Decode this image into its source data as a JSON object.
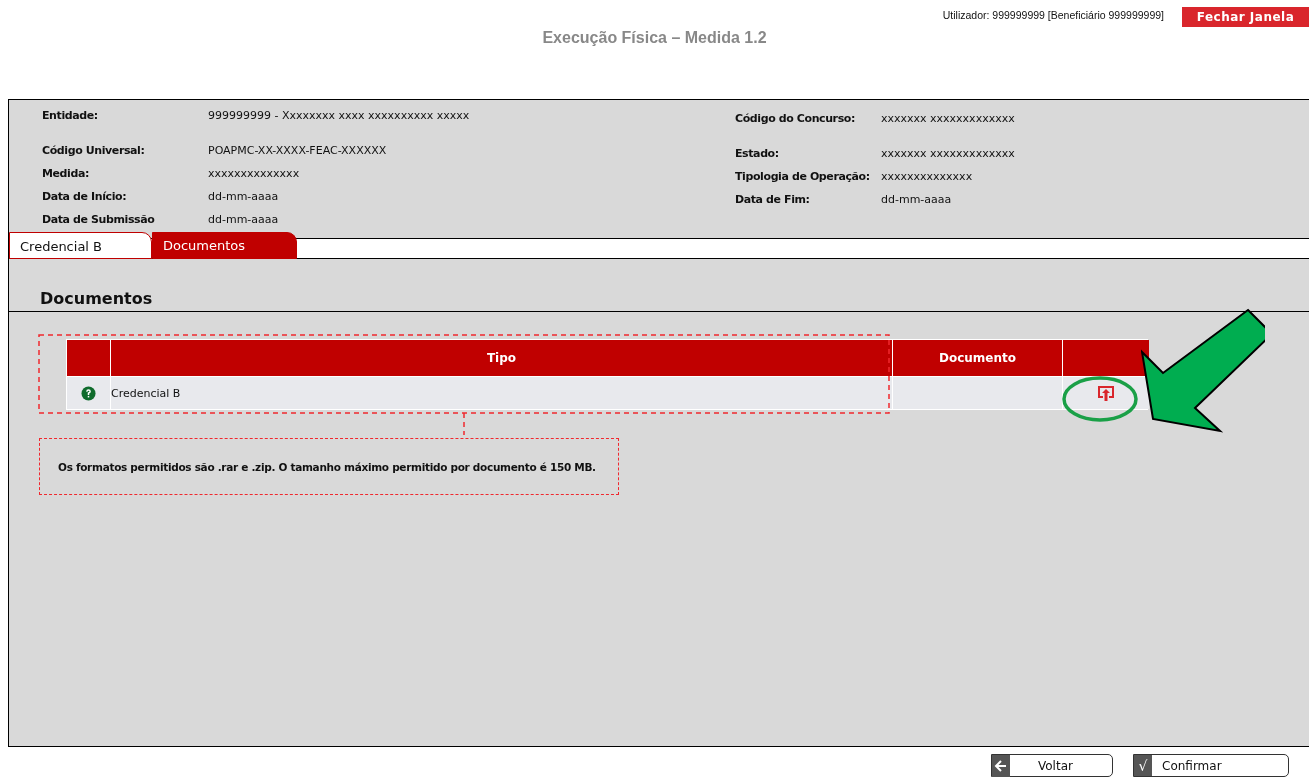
{
  "header": {
    "user": "Utilizador: 999999999 [Beneficiário 999999999]",
    "close_button": "Fechar Janela",
    "title": "Execução Física – Medida 1.2"
  },
  "info_left": [
    {
      "label": "Entidade:",
      "value": "999999999 - Xxxxxxxx xxxx xxxxxxxxxx xxxxx"
    },
    {
      "label": "Código Universal:",
      "value": "POAPMC-XX-XXXX-FEAC-XXXXXX"
    },
    {
      "label": "Medida:",
      "value": "xxxxxxxxxxxxxx"
    },
    {
      "label": "Data de Início:",
      "value": "dd-mm-aaaa"
    },
    {
      "label": "Data de Submissão",
      "value": "dd-mm-aaaa"
    }
  ],
  "info_right": [
    {
      "label": "Código do Concurso:",
      "value": "xxxxxxx xxxxxxxxxxxxx"
    },
    {
      "label": "Estado:",
      "value": "xxxxxxx xxxxxxxxxxxxx"
    },
    {
      "label": "Tipologia de Operação:",
      "value": "xxxxxxxxxxxxxx"
    },
    {
      "label": "Data de Fim:",
      "value": "dd-mm-aaaa"
    }
  ],
  "tabs": [
    {
      "label": "Credencial B",
      "selected": false
    },
    {
      "label": "Documentos",
      "selected": true
    }
  ],
  "section_title": "Documentos",
  "table": {
    "columns": [
      "Tipo",
      "Documento"
    ],
    "rows": [
      {
        "tipo": "Credencial B"
      }
    ]
  },
  "note": "Os formatos permitidos são .rar e .zip. O tamanho máximo permitido por documento é 150 MB.",
  "buttons": [
    {
      "kind": "back",
      "label": "Voltar"
    },
    {
      "kind": "confirm",
      "glyph": "√",
      "label": "Confirmar"
    }
  ]
}
